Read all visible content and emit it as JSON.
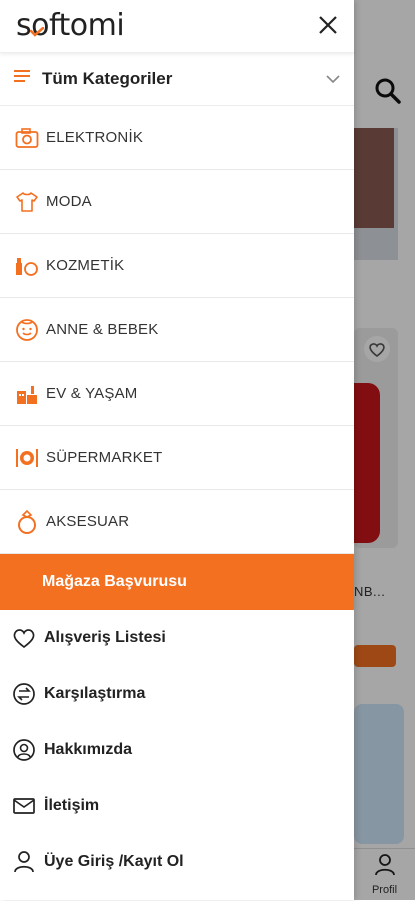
{
  "brand": {
    "logo_text": "softomi",
    "accent": "#f37021"
  },
  "drawer": {
    "all_categories_label": "Tüm Kategoriler",
    "categories": [
      {
        "label": "ELEKTRONİK",
        "icon": "camera-icon"
      },
      {
        "label": "MODA",
        "icon": "tshirt-icon"
      },
      {
        "label": "KOZMETİK",
        "icon": "cosmetics-icon"
      },
      {
        "label": "ANNE & BEBEK",
        "icon": "baby-icon"
      },
      {
        "label": "EV & YAŞAM",
        "icon": "home-icon"
      },
      {
        "label": "SÜPERMARKET",
        "icon": "cutlery-icon"
      },
      {
        "label": "AKSESUAR",
        "icon": "ring-icon"
      }
    ],
    "store_application_label": "Mağaza Başvurusu",
    "links": [
      {
        "label": "Alışveriş Listesi",
        "icon": "heart-icon"
      },
      {
        "label": "Karşılaştırma",
        "icon": "compare-icon"
      },
      {
        "label": "Hakkımızda",
        "icon": "about-icon"
      },
      {
        "label": "İletişim",
        "icon": "mail-icon"
      },
      {
        "label": "Üye Giriş /Kayıt Ol",
        "icon": "user-icon"
      }
    ]
  },
  "background": {
    "product_text": "NB...",
    "profile_label": "Profil"
  }
}
